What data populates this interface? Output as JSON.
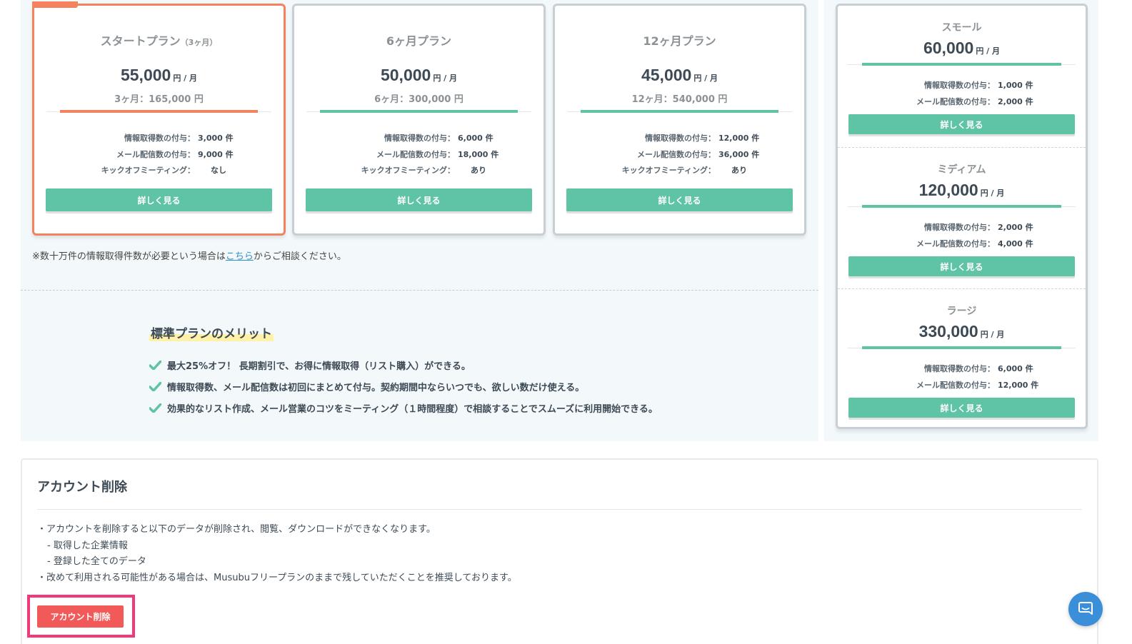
{
  "plans": [
    {
      "name": "スタートプラン",
      "name_sub": "（3ヶ月）",
      "price": "55,000",
      "unit": "円 / 月",
      "total": "3ヶ月：165,000 円",
      "details": [
        {
          "label": "情報取得数の付与：",
          "value": "3,000 件"
        },
        {
          "label": "メール配信数の付与：",
          "value": "9,000 件"
        },
        {
          "label": "キックオフミーティング：",
          "value": "なし"
        }
      ],
      "button": "詳しく見る"
    },
    {
      "name": "6ヶ月プラン",
      "name_sub": "",
      "price": "50,000",
      "unit": "円 / 月",
      "total": "6ヶ月：300,000 円",
      "details": [
        {
          "label": "情報取得数の付与：",
          "value": "6,000 件"
        },
        {
          "label": "メール配信数の付与：",
          "value": "18,000 件"
        },
        {
          "label": "キックオフミーティング：",
          "value": "あり"
        }
      ],
      "button": "詳しく見る"
    },
    {
      "name": "12ヶ月プラン",
      "name_sub": "",
      "price": "45,000",
      "unit": "円 / 月",
      "total": "12ヶ月：540,000 円",
      "details": [
        {
          "label": "情報取得数の付与：",
          "value": "12,000 件"
        },
        {
          "label": "メール配信数の付与：",
          "value": "36,000 件"
        },
        {
          "label": "キックオフミーティング：",
          "value": "あり"
        }
      ],
      "button": "詳しく見る"
    }
  ],
  "note": {
    "before": "※数十万件の情報取得件数が必要という場合は",
    "link": "こちら",
    "after": "からご相談ください。"
  },
  "merit": {
    "title": "標準プランのメリット",
    "items": [
      "最大25%オフ！ 長期割引で、お得に情報取得（リスト購入）ができる。",
      "情報取得数、メール配信数は初回にまとめて付与。契約期間中ならいつでも、欲しい数だけ使える。",
      "効果的なリスト作成、メール営業のコツをミーティング（１時間程度）で相談することでスムーズに利用開始できる。"
    ]
  },
  "options": [
    {
      "name": "スモール",
      "price": "60,000",
      "unit": "円 / 月",
      "details": [
        {
          "label": "情報取得数の付与：",
          "value": "1,000 件"
        },
        {
          "label": "メール配信数の付与：",
          "value": "2,000 件"
        }
      ],
      "button": "詳しく見る"
    },
    {
      "name": "ミディアム",
      "price": "120,000",
      "unit": "円 / 月",
      "details": [
        {
          "label": "情報取得数の付与：",
          "value": "2,000 件"
        },
        {
          "label": "メール配信数の付与：",
          "value": "4,000 件"
        }
      ],
      "button": "詳しく見る"
    },
    {
      "name": "ラージ",
      "price": "330,000",
      "unit": "円 / 月",
      "details": [
        {
          "label": "情報取得数の付与：",
          "value": "6,000 件"
        },
        {
          "label": "メール配信数の付与：",
          "value": "12,000 件"
        }
      ],
      "button": "詳しく見る"
    }
  ],
  "account": {
    "title": "アカウント削除",
    "lines": [
      "・アカウントを削除すると以下のデータが削除され、閲覧、ダウンロードができなくなります。",
      "- 取得した企業情報",
      "- 登録した全てのデータ",
      "・改めて利用される可能性がある場合は、Musubuフリープランのままで残していただくことを推奨しております。"
    ],
    "delete_button": "アカウント削除"
  },
  "colors": {
    "accent": "#5fc3a6",
    "featured": "#f5825f",
    "danger": "#f25a5a",
    "highlight": "#f0387a",
    "chat": "#3b8ed8"
  },
  "icons": {
    "merit_check": "check-icon",
    "chat": "chat-icon"
  }
}
